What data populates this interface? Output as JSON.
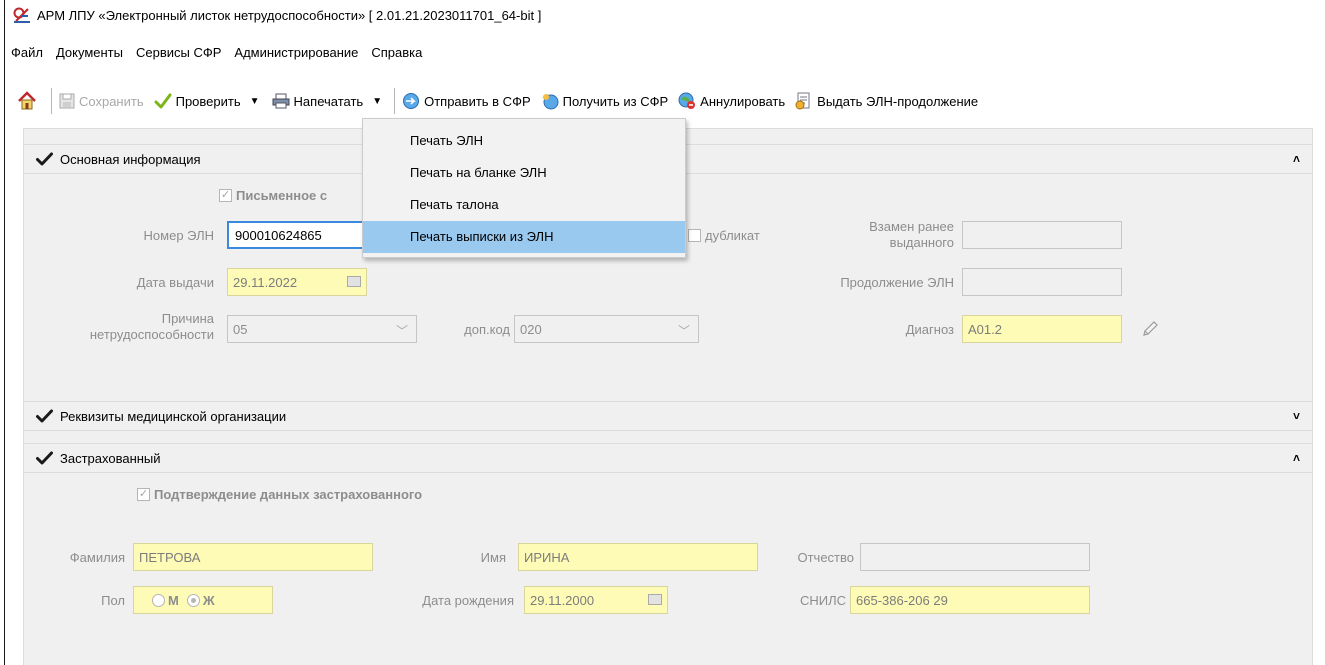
{
  "window": {
    "title": "АРМ ЛПУ «Электронный листок нетрудоспособности»  [ 2.01.21.2023011701_64-bit ]"
  },
  "menu": [
    "Файл",
    "Документы",
    "Сервисы СФР",
    "Администрирование",
    "Справка"
  ],
  "toolbar": {
    "save": "Сохранить",
    "check": "Проверить",
    "print": "Напечатать",
    "send": "Отправить в СФР",
    "receive": "Получить из СФР",
    "cancel": "Аннулировать",
    "continue": "Выдать ЭЛН-продолжение"
  },
  "print_menu": {
    "items": [
      "Печать ЭЛН",
      "Печать на бланке ЭЛН",
      "Печать талона",
      "Печать выписки из ЭЛН"
    ],
    "highlighted": "Печать выписки из ЭЛН"
  },
  "main_info": {
    "header": "Основная информация",
    "written_consent": "Письменное с",
    "eln_number_label": "Номер ЭЛН",
    "eln_number": "900010624865",
    "duplicate": "дубликат",
    "replaces_label_1": "Взамен ранее",
    "replaces_label_2": "выданного",
    "replaces_value": "",
    "issue_date_label": "Дата выдачи",
    "issue_date": "29.11.2022",
    "continuation_label": "Продолжение ЭЛН",
    "continuation_value": "",
    "reason_label_1": "Причина",
    "reason_label_2": "нетрудоспособности",
    "reason": "05",
    "extra_code_label": "доп.код",
    "extra_code": "020",
    "diagnosis_label": "Диагноз",
    "diagnosis": "А01.2"
  },
  "med_org": {
    "header": "Реквизиты медицинской организации"
  },
  "insured": {
    "header": "Застрахованный",
    "confirm": "Подтверждение данных застрахованного",
    "surname_label": "Фамилия",
    "surname": "ПЕТРОВА",
    "name_label": "Имя",
    "name": "ИРИНА",
    "patronymic_label": "Отчество",
    "patronymic": "",
    "sex_label": "Пол",
    "sex_m": "М",
    "sex_f": "Ж",
    "sex_selected": "Ж",
    "birth_label": "Дата рождения",
    "birth_date": "29.11.2000",
    "snils_label": "СНИЛС",
    "snils": "665-386-206 29"
  },
  "colors": {
    "required_field": "#fdfbb6",
    "highlight": "#99c9ef",
    "focus_border": "#3a88e0"
  }
}
